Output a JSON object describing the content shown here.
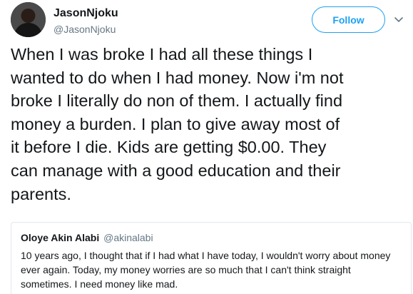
{
  "author": {
    "name": "JasonNjoku",
    "handle": "@JasonNjoku",
    "avatar_icon": "user-avatar"
  },
  "actions": {
    "follow_label": "Follow",
    "more_icon": "chevron-down-icon",
    "accent_color": "#1da1f2"
  },
  "tweet": {
    "text": "When I was broke I had all these things I\nwanted to do when I had money. Now i'm not\nbroke I literally do non of them. I actually find\nmoney a burden. I plan to give away most of\nit before I die. Kids are getting $0.00. They\ncan manage with a good education and their\nparents."
  },
  "quoted_tweet": {
    "name": "Oloye Akin Alabi",
    "handle": "@akinalabi",
    "text": "10 years ago, I thought that if I had what I have today, I wouldn't worry about money\never again. Today, my money worries are so much that I can't think straight\nsometimes. I need money like mad."
  }
}
